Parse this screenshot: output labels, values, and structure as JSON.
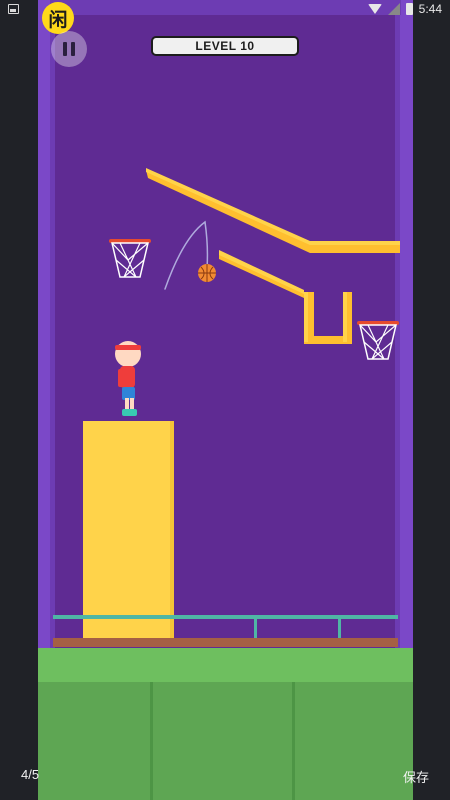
{
  "status_bar": {
    "time": "5:44",
    "icons": [
      "photo-icon",
      "wifi-icon",
      "no-signal-icon",
      "battery-icon"
    ]
  },
  "app": {
    "logo_glyph": "闲"
  },
  "game": {
    "level_label": "LEVEL 10",
    "pause_icon": "pause-icon",
    "colors": {
      "background": "#5f2b93",
      "wall": "#7b48c8",
      "platform": "#ffd34a",
      "ramp": "#ffbf2f",
      "floor": "#5ea653",
      "ball": "#f28b32"
    }
  },
  "viewer": {
    "counter": "4/5",
    "save_label": "保存"
  }
}
